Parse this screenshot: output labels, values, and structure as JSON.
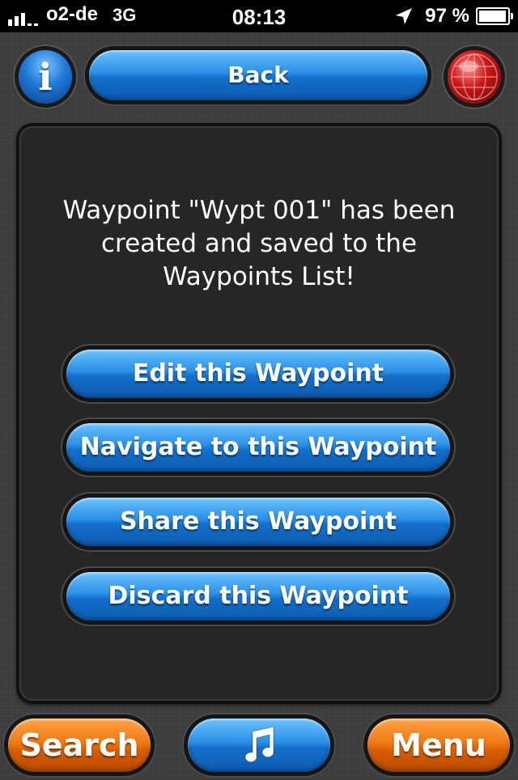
{
  "status_bar": {
    "carrier": "o2-de",
    "network": "3G",
    "time": "08:13",
    "battery_percent": "97 %",
    "battery_level": 0.97,
    "signal_bars_active": 3,
    "signal_bars_total": 5,
    "location_icon": "location-arrow-icon"
  },
  "top_nav": {
    "info_icon_glyph": "i",
    "back_label": "Back",
    "globe_icon": "globe-icon"
  },
  "dialog": {
    "message": "Waypoint \"Wypt 001\" has been created and saved to the Waypoints List!",
    "actions": [
      {
        "label": "Edit this Waypoint"
      },
      {
        "label": "Navigate to this Waypoint"
      },
      {
        "label": "Share this Waypoint"
      },
      {
        "label": "Discard this Waypoint"
      }
    ]
  },
  "bottom_bar": {
    "search_label": "Search",
    "music_icon": "music-note-icon",
    "menu_label": "Menu"
  },
  "colors": {
    "accent_blue": "#1e78d8",
    "accent_orange": "#f07a14",
    "panel_bg": "#262626",
    "status_bar_bg": "#000000"
  }
}
